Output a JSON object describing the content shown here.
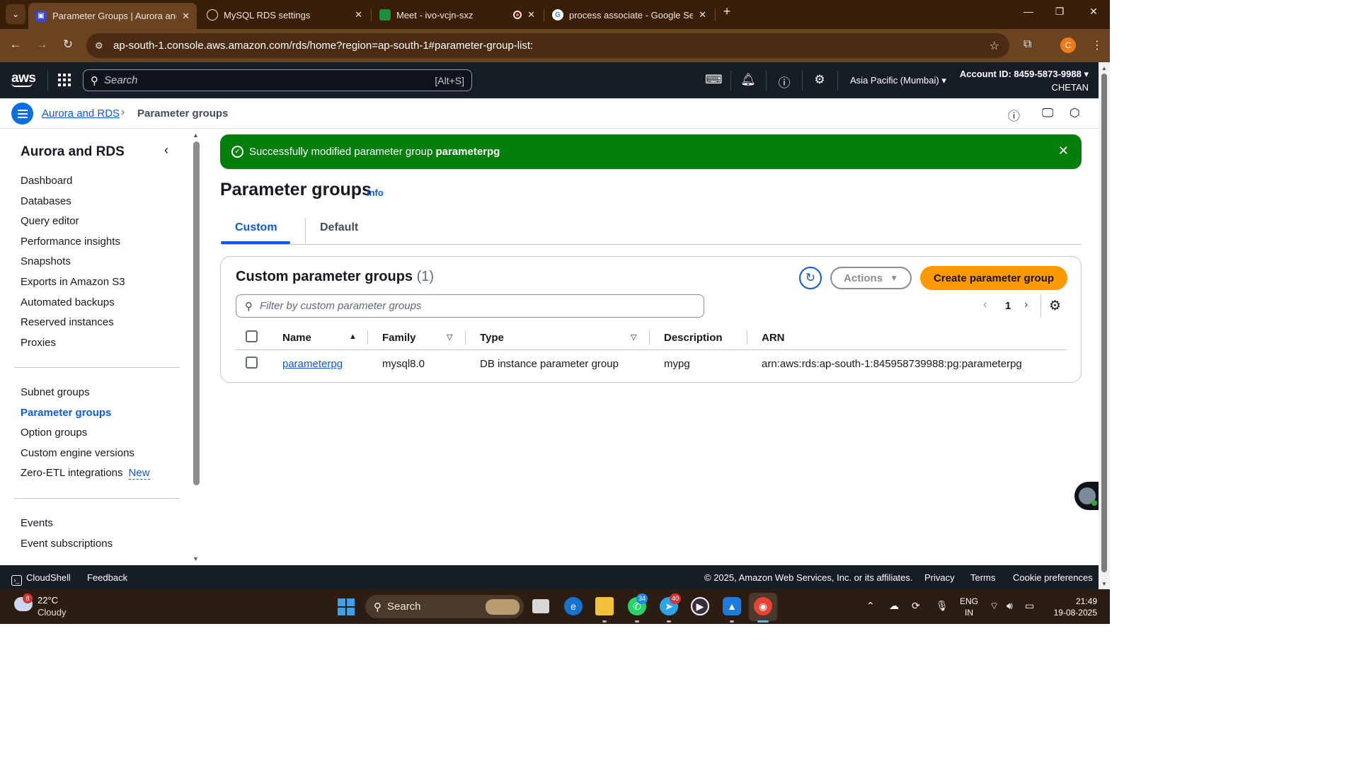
{
  "browser": {
    "tabs": [
      {
        "title": "Parameter Groups | Aurora and",
        "icon": "aws-rds-favicon",
        "active": true
      },
      {
        "title": "MySQL RDS settings",
        "icon": "openai-favicon",
        "active": false
      },
      {
        "title": "Meet - ivo-vcjn-sxz",
        "icon": "google-meet-favicon",
        "active": false
      },
      {
        "title": "process associate - Google Sear",
        "icon": "google-favicon",
        "active": false
      }
    ],
    "close_glyph": "✕",
    "new_tab_glyph": "+",
    "url": "ap-south-1.console.aws.amazon.com/rds/home?region=ap-south-1#parameter-group-list:",
    "profile_initial": "C"
  },
  "aws_header": {
    "logo": "aws",
    "search_placeholder": "Search",
    "search_shortcut": "[Alt+S]",
    "region": "Asia Pacific (Mumbai)",
    "account_id": "Account ID: 8459-5873-9988",
    "account_user": "CHETAN"
  },
  "breadcrumb": {
    "parent": "Aurora and RDS",
    "current": "Parameter groups"
  },
  "sidebar": {
    "title": "Aurora and RDS",
    "group1": [
      "Dashboard",
      "Databases",
      "Query editor",
      "Performance insights",
      "Snapshots",
      "Exports in Amazon S3",
      "Automated backups",
      "Reserved instances",
      "Proxies"
    ],
    "group2": [
      "Subnet groups",
      "Parameter groups",
      "Option groups",
      "Custom engine versions",
      "Zero-ETL integrations"
    ],
    "group2_badge": "New",
    "active_item": "Parameter groups",
    "group3": [
      "Events",
      "Event subscriptions"
    ]
  },
  "flash": {
    "message": "Successfully modified parameter group",
    "group_name": "parameterpg"
  },
  "page": {
    "title": "Parameter groups",
    "info": "Info",
    "tabs": [
      "Custom",
      "Default"
    ],
    "active_tab": "Custom"
  },
  "panel": {
    "title": "Custom parameter groups",
    "count": "(1)",
    "actions_label": "Actions",
    "create_label": "Create parameter group",
    "filter_placeholder": "Filter by custom parameter groups",
    "page_number": "1",
    "columns": [
      "Name",
      "Family",
      "Type",
      "Description",
      "ARN"
    ],
    "rows": [
      {
        "name": "parameterpg",
        "family": "mysql8.0",
        "type": "DB instance parameter group",
        "description": "mypg",
        "arn": "arn:aws:rds:ap-south-1:845958739988:pg:parameterpg"
      }
    ]
  },
  "footer": {
    "cloudshell": "CloudShell",
    "feedback": "Feedback",
    "copyright": "© 2025, Amazon Web Services, Inc. or its affiliates.",
    "privacy": "Privacy",
    "terms": "Terms",
    "cookies": "Cookie preferences"
  },
  "taskbar": {
    "weather_temp": "22°C",
    "weather_desc": "Cloudy",
    "weather_badge": "8",
    "search_label": "Search",
    "whatsapp_badge": "34",
    "telegram_badge": "40",
    "lang_top": "ENG",
    "lang_bottom": "IN",
    "time": "21:49",
    "date": "19-08-2025"
  },
  "colors": {
    "flash_green": "#037f0c",
    "link_blue": "#0a5ae0",
    "create_orange": "#ff9900",
    "aws_header_bg": "#161d26",
    "browser_bg": "#3a1f08"
  }
}
